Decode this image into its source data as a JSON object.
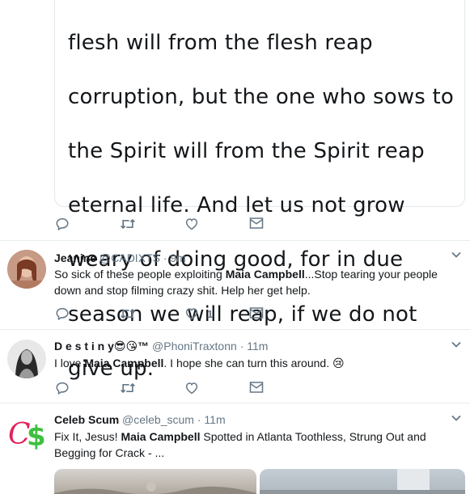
{
  "quoted_tweet": {
    "text_lines": [
      "flesh will from the flesh reap",
      "corruption, but the one who sows to",
      "the Spirit will from the Spirit reap",
      "eternal life. And let us not grow",
      "weary of doing good, for in due",
      "season we will reap, if we do not",
      "give up."
    ]
  },
  "top_actions": {
    "reply_count": "",
    "retweet_count": "",
    "like_count": ""
  },
  "tweets": [
    {
      "name": "Jeanine",
      "handle": "@CADIXTS",
      "dot": "·",
      "time": "9m",
      "text_before": "So sick of these people exploiting ",
      "text_bold": "Maia Campbell",
      "text_after": "...Stop tearing your people down and stop filming crazy shit. Help her get help.",
      "like_count": "1"
    },
    {
      "name": "D e s t i n y",
      "name_emoji": "😎😘™",
      "handle": "@PhoniTraxtonn",
      "dot": "·",
      "time": "11m",
      "text_before": "I love ",
      "text_bold": "Maia Campbell",
      "text_after": ". I hope she can turn this around. ",
      "text_emoji": "😢",
      "like_count": ""
    },
    {
      "name": "Celeb Scum",
      "handle": "@celeb_scum",
      "dot": "·",
      "time": "11m",
      "text_before": "Fix It, Jesus! ",
      "text_bold": "Maia Campbell",
      "text_after": " Spotted in Atlanta Toothless, Strung Out and Begging for Crack - ...",
      "avatar_logo": "C$"
    }
  ],
  "colors": {
    "text": "#14171a",
    "secondary": "#657786",
    "divider": "#e6ecf0",
    "logo_red": "#e0245e",
    "logo_green": "#3fbf3f"
  },
  "icons": [
    "reply-icon",
    "retweet-icon",
    "like-icon",
    "direct-message-icon",
    "caret-down-icon"
  ]
}
